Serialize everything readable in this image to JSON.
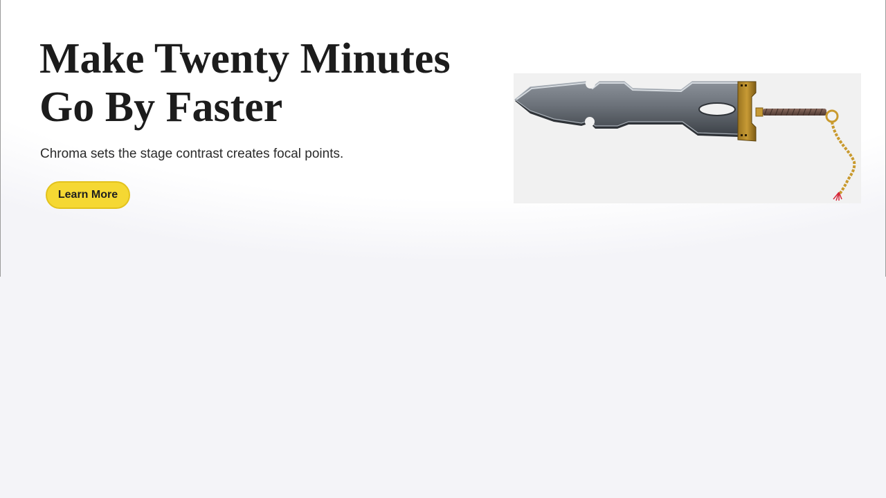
{
  "hero": {
    "headline": "Make Twenty Minutes Go By Faster",
    "subtitle": "Chroma sets the stage contrast creates focal points.",
    "cta_label": "Learn More"
  },
  "product_image": {
    "icon": "sword-illustration",
    "background_color": "#f1f1f1"
  },
  "colors": {
    "cta_fill": "#f5d833",
    "cta_border": "#e2c21d",
    "page_background": "#f4f4f8",
    "headline_text": "#1c1c1c"
  }
}
